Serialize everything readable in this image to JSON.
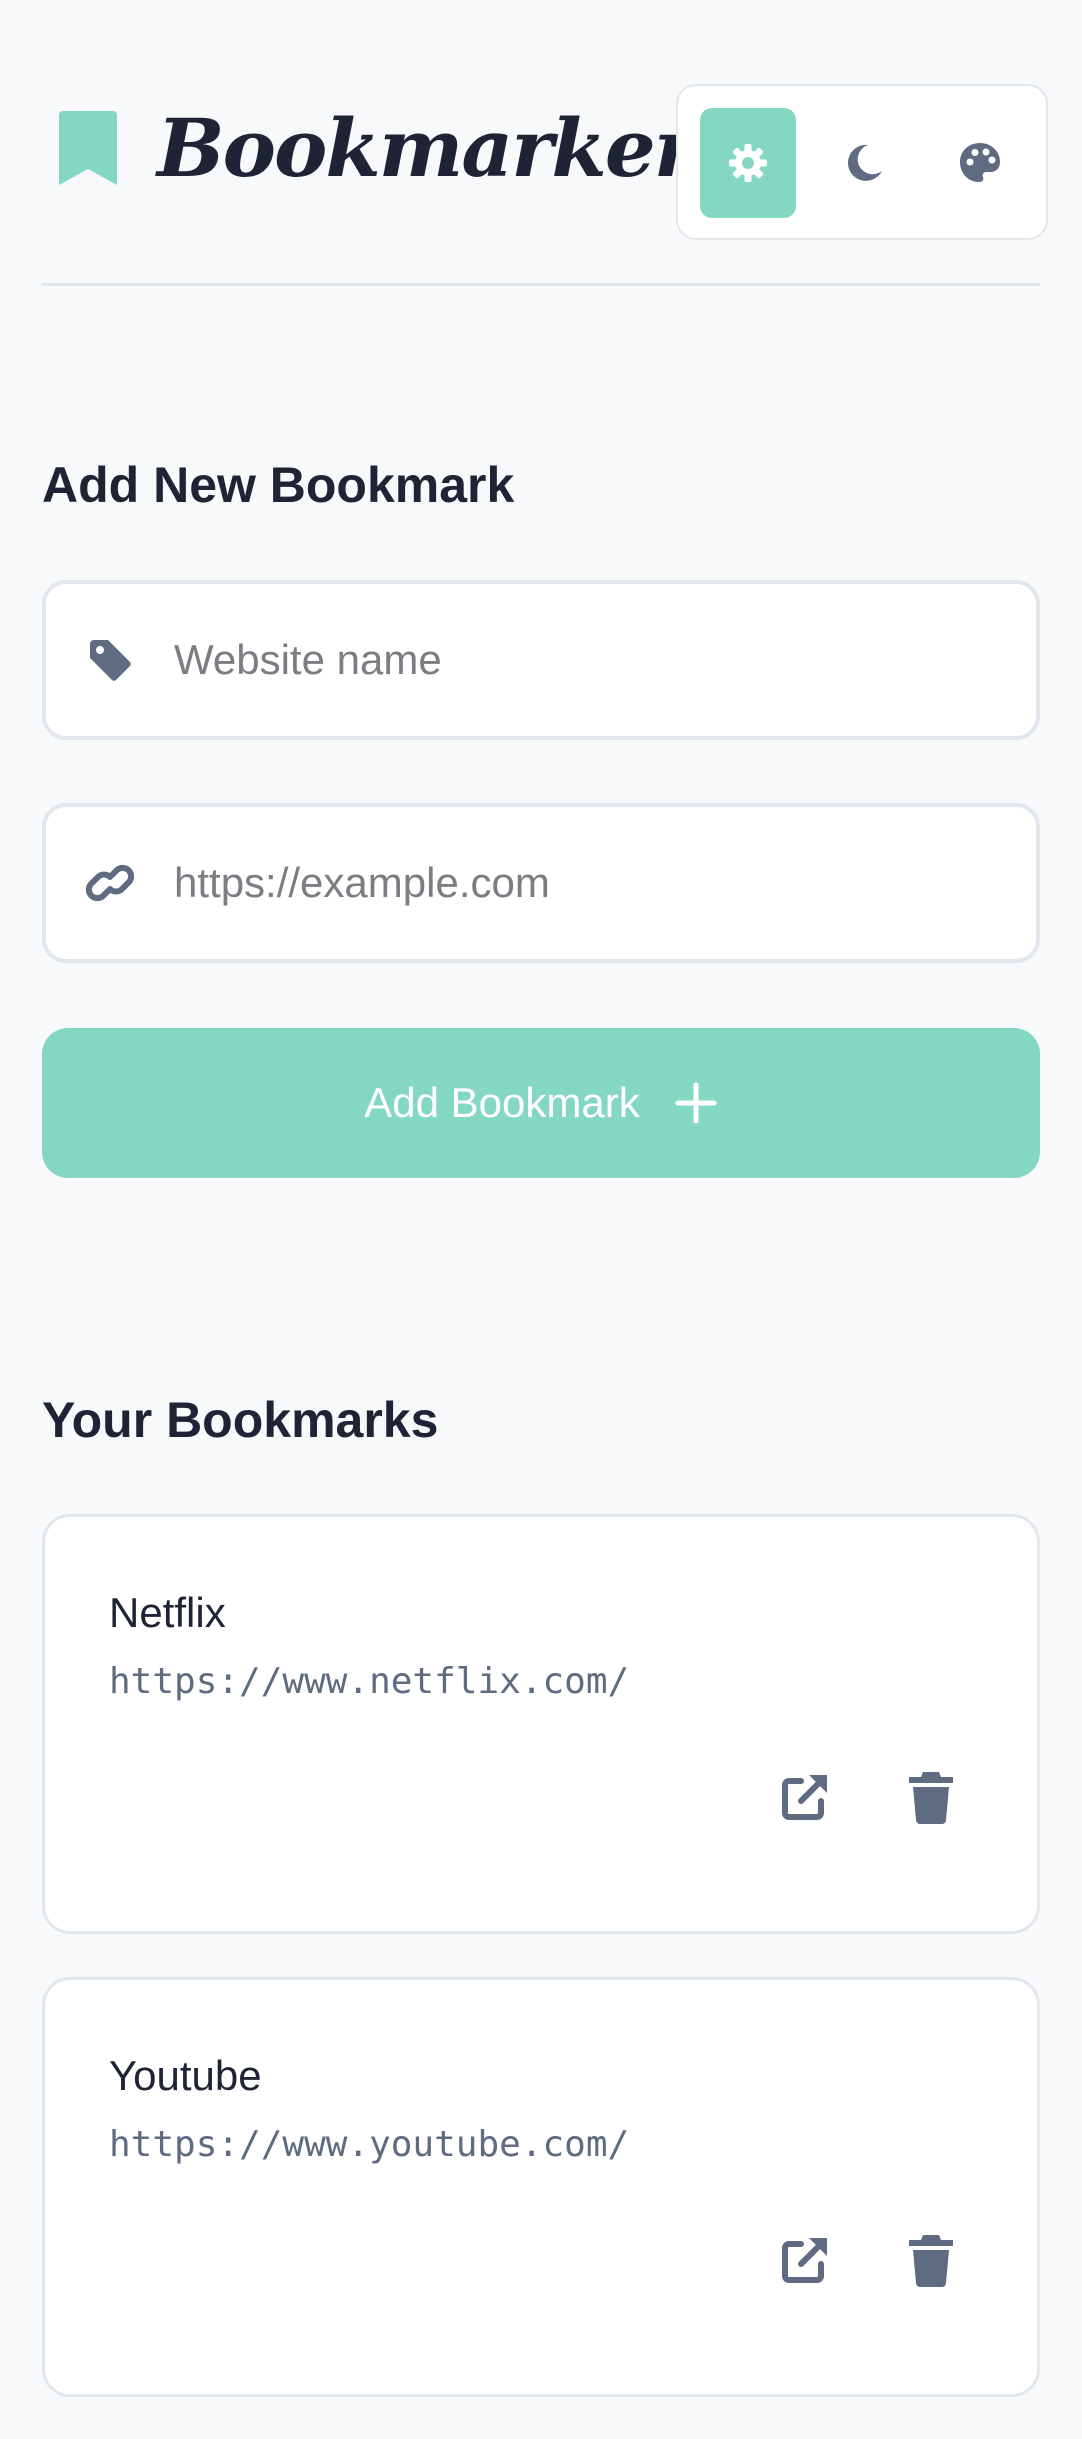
{
  "app": {
    "title": "Bookmarker"
  },
  "theme_switcher": {
    "options": [
      {
        "icon": "gear-icon",
        "active": true
      },
      {
        "icon": "moon-icon",
        "active": false
      },
      {
        "icon": "palette-icon",
        "active": false
      }
    ]
  },
  "colors": {
    "accent": "#84d8c2",
    "text": "#1e2436",
    "muted": "#5f6b80",
    "border": "#e2e7ee",
    "background": "#f8f9fb"
  },
  "form": {
    "title": "Add New Bookmark",
    "name_field": {
      "placeholder": "Website name",
      "value": "",
      "icon": "tag-icon"
    },
    "url_field": {
      "placeholder": "https://example.com",
      "value": "",
      "icon": "link-icon"
    },
    "submit_label": "Add Bookmark",
    "submit_icon": "plus-icon"
  },
  "bookmarks": {
    "title": "Your Bookmarks",
    "items": [
      {
        "name": "Netflix",
        "url": "https://www.netflix.com/",
        "open_icon": "external-link-icon",
        "delete_icon": "trash-icon"
      },
      {
        "name": "Youtube",
        "url": "https://www.youtube.com/",
        "open_icon": "external-link-icon",
        "delete_icon": "trash-icon"
      }
    ]
  }
}
